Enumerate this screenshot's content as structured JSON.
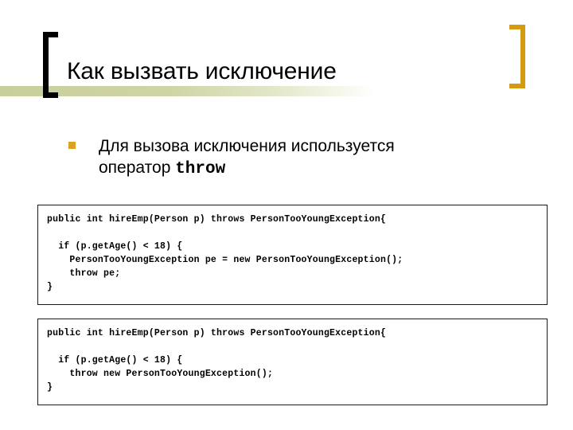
{
  "slide": {
    "title": "Как вызвать исключение",
    "decorations": {
      "left_bracket_color": "#000000",
      "right_bracket_color": "#d49b10",
      "band_color": "#c9cf9a",
      "bullet_color": "#d9a222"
    },
    "bullet": {
      "marker": "square-bullet-icon",
      "text_before": "Для вызова исключения используется оператор ",
      "keyword": "throw"
    },
    "code_blocks": [
      {
        "id": "code-box-1",
        "lines": [
          "public int hireEmp(Person p) throws PersonTooYoungException{",
          "",
          "  if (p.getAge() < 18) {",
          "    PersonTooYoungException pe = new PersonTooYoungException();",
          "    throw pe;",
          "}"
        ]
      },
      {
        "id": "code-box-2",
        "lines": [
          "public int hireEmp(Person p) throws PersonTooYoungException{",
          "",
          "  if (p.getAge() < 18) {",
          "    throw new PersonTooYoungException();",
          "}"
        ]
      }
    ]
  }
}
